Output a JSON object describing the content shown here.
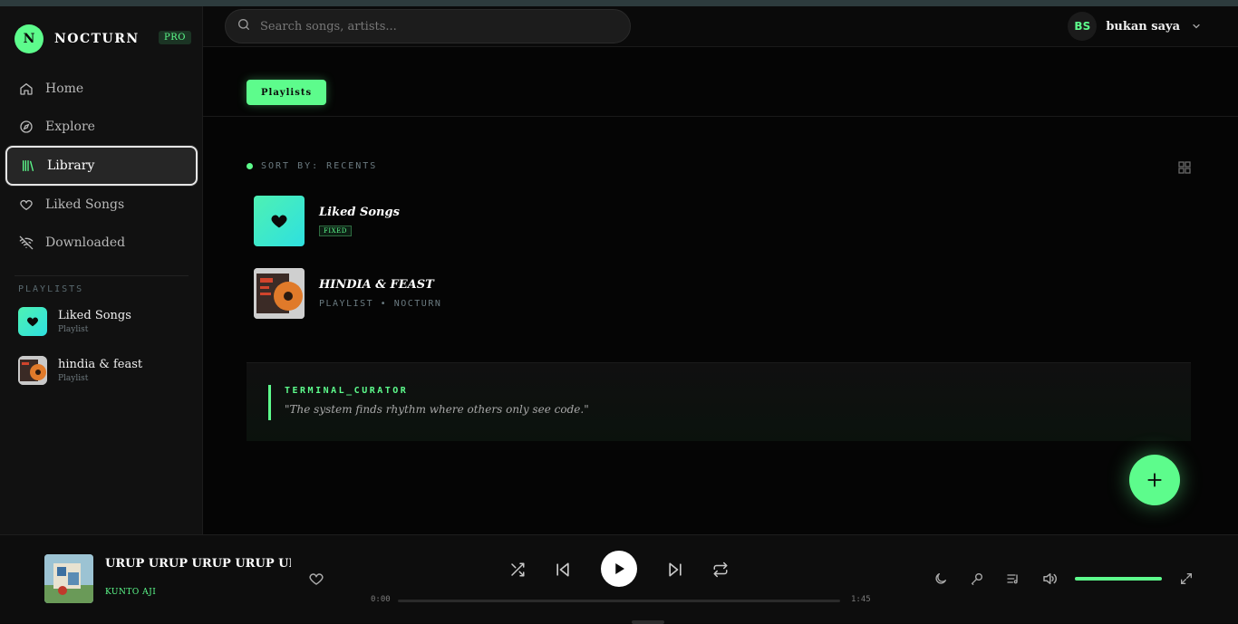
{
  "app": {
    "brand_initial": "N",
    "brand_name": "NOCTURN",
    "badge": "PRO"
  },
  "sidebar": {
    "nav": [
      {
        "label": "Home",
        "icon": "home-icon"
      },
      {
        "label": "Explore",
        "icon": "compass-icon"
      },
      {
        "label": "Library",
        "icon": "library-icon",
        "active": true
      },
      {
        "label": "Liked Songs",
        "icon": "heart-icon"
      },
      {
        "label": "Downloaded",
        "icon": "wifi-off-icon"
      }
    ],
    "playlists_header": "PLAYLISTS",
    "playlists": [
      {
        "title": "Liked Songs",
        "subtitle": "Playlist"
      },
      {
        "title": "hindia & feast",
        "subtitle": "Playlist"
      }
    ]
  },
  "header": {
    "search_placeholder": "Search songs, artists...",
    "user_initials": "BS",
    "user_name": "bukan saya"
  },
  "main": {
    "tab": "Playlists",
    "sort_label": "SORT BY: RECENTS",
    "items": [
      {
        "title": "Liked Songs",
        "badge": "FIXED"
      },
      {
        "title": "HINDIA & FEAST",
        "subtitle": "PLAYLIST • NOCTURN"
      }
    ],
    "curator_label": "TERMINAL_CURATOR",
    "curator_quote": "\"The system finds rhythm where others only see code.\""
  },
  "player": {
    "title": "URUP URUP URUP URUP URUP URUP",
    "artist": "KUNTO AJI",
    "current_time": "0:00",
    "total_time": "1:45",
    "progress": 0,
    "volume": 1.0
  },
  "colors": {
    "accent": "#5dfc8c",
    "background": "#050505",
    "sidebar": "#111111"
  }
}
